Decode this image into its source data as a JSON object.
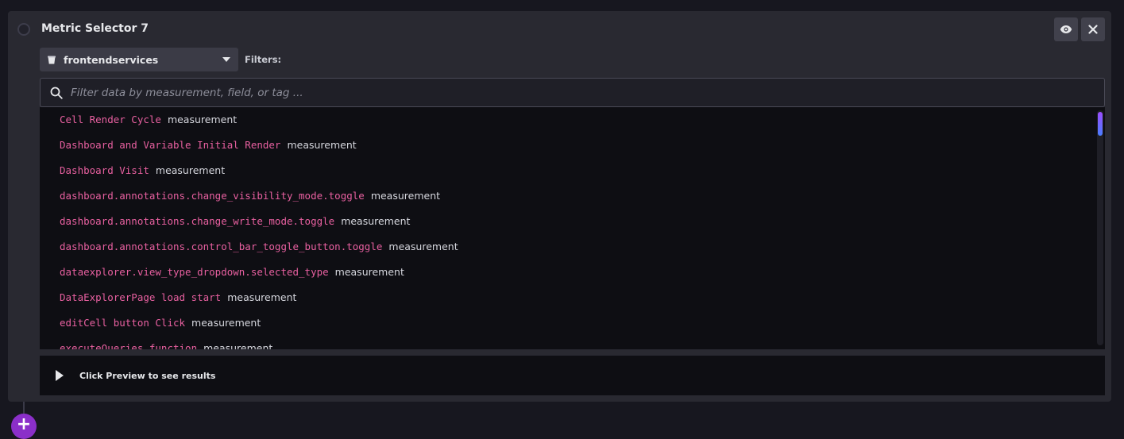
{
  "panel": {
    "title": "Metric Selector 7",
    "bucket": "frontendservices",
    "filters_label": "Filters:",
    "search_placeholder": "Filter data by measurement, field, or tag ...",
    "results": [
      {
        "name": "Cell Render Cycle",
        "type": "measurement"
      },
      {
        "name": "Dashboard and Variable Initial Render",
        "type": "measurement"
      },
      {
        "name": "Dashboard Visit",
        "type": "measurement"
      },
      {
        "name": "dashboard.annotations.change_visibility_mode.toggle",
        "type": "measurement"
      },
      {
        "name": "dashboard.annotations.change_write_mode.toggle",
        "type": "measurement"
      },
      {
        "name": "dashboard.annotations.control_bar_toggle_button.toggle",
        "type": "measurement"
      },
      {
        "name": "dataexplorer.view_type_dropdown.selected_type",
        "type": "measurement"
      },
      {
        "name": "DataExplorerPage load start",
        "type": "measurement"
      },
      {
        "name": "editCell button Click",
        "type": "measurement"
      },
      {
        "name": "executeQueries function",
        "type": "measurement"
      }
    ],
    "preview_text": "Click Preview to see results"
  },
  "icons": {
    "eye": "eye-icon",
    "close": "close-icon",
    "bucket": "bucket-icon",
    "caret": "caret-down-icon",
    "search": "search-icon",
    "play": "play-icon",
    "add": "plus-icon"
  },
  "colors": {
    "measurement_name": "#e860a0",
    "accent": "#8b2fc9"
  }
}
